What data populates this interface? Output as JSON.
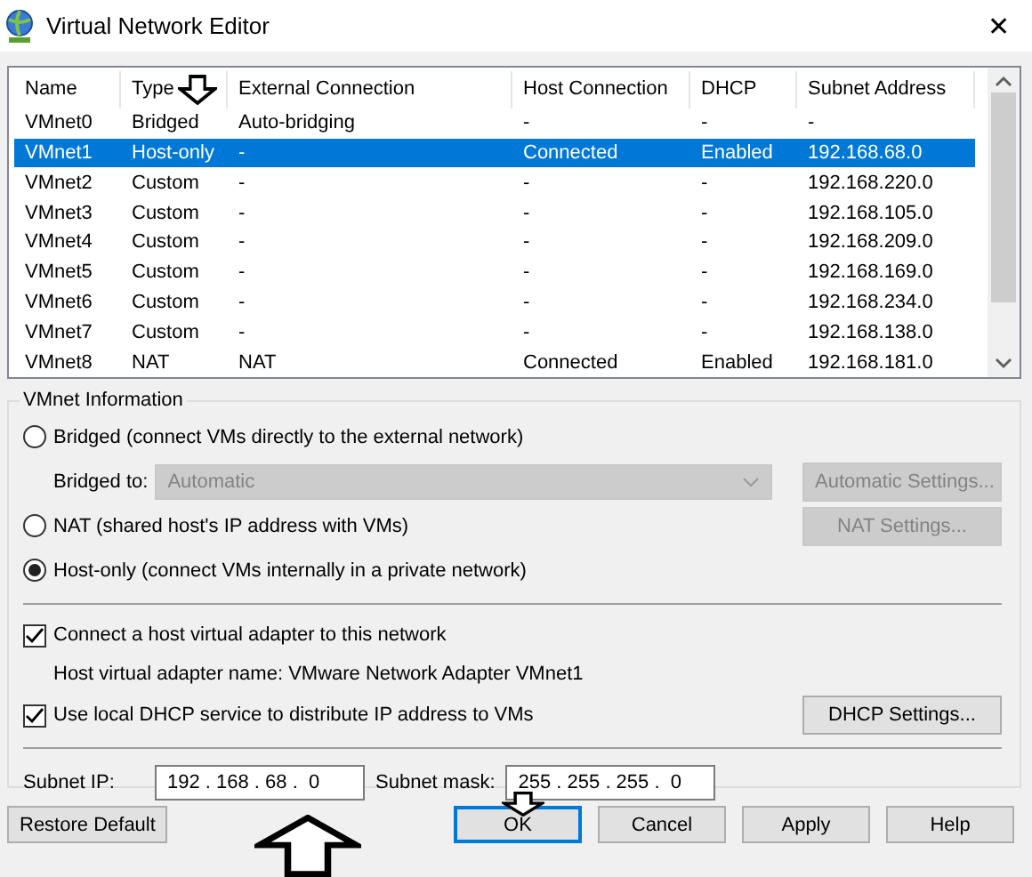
{
  "window": {
    "title": "Virtual Network Editor",
    "close": "✕"
  },
  "network_table": {
    "columns": [
      "Name",
      "Type",
      "External Connection",
      "Host Connection",
      "DHCP",
      "Subnet Address"
    ],
    "rows": [
      {
        "cells": [
          "VMnet0",
          "Bridged",
          "Auto-bridging",
          "-",
          "-",
          "-"
        ],
        "selected": false
      },
      {
        "cells": [
          "VMnet1",
          "Host-only",
          "-",
          "Connected",
          "Enabled",
          "192.168.68.0"
        ],
        "selected": true
      },
      {
        "cells": [
          "VMnet2",
          "Custom",
          "-",
          "-",
          "-",
          "192.168.220.0"
        ],
        "selected": false
      },
      {
        "cells": [
          "VMnet3",
          "Custom",
          "-",
          "-",
          "-",
          "192.168.105.0"
        ],
        "selected": false
      },
      {
        "cells": [
          "VMnet4",
          "Custom",
          "-",
          "-",
          "-",
          "192.168.209.0"
        ],
        "selected": false
      },
      {
        "cells": [
          "VMnet5",
          "Custom",
          "-",
          "-",
          "-",
          "192.168.169.0"
        ],
        "selected": false
      },
      {
        "cells": [
          "VMnet6",
          "Custom",
          "-",
          "-",
          "-",
          "192.168.234.0"
        ],
        "selected": false
      },
      {
        "cells": [
          "VMnet7",
          "Custom",
          "-",
          "-",
          "-",
          "192.168.138.0"
        ],
        "selected": false
      },
      {
        "cells": [
          "VMnet8",
          "NAT",
          "NAT",
          "Connected",
          "Enabled",
          "192.168.181.0"
        ],
        "selected": false
      }
    ]
  },
  "vmnet_info": {
    "title": "VMnet Information",
    "options": [
      {
        "label": "Bridged (connect VMs directly to the external network)",
        "selected": false
      },
      {
        "label": "NAT (shared host's IP address with VMs)",
        "selected": false
      },
      {
        "label": "Host-only (connect VMs internally in a private network)",
        "selected": true
      }
    ],
    "bridged_to": {
      "label": "Bridged to:",
      "value": "Automatic",
      "disabled": true
    },
    "automatic_settings": {
      "label": "Automatic Settings...",
      "disabled": true
    },
    "nat_settings": {
      "label": "NAT Settings...",
      "disabled": true
    },
    "checkboxes": [
      {
        "label": "Connect a host virtual adapter to this network",
        "checked": true
      },
      {
        "label": "Use local DHCP service to distribute IP address to VMs",
        "checked": true
      }
    ],
    "adapter_name": "Host virtual adapter name: VMware Network Adapter VMnet1",
    "dhcp_settings": {
      "label": "DHCP Settings...",
      "disabled": false
    },
    "subnet_ip": {
      "label": "Subnet IP:",
      "value": "192 . 168 . 68 .  0"
    },
    "subnet_mask": {
      "label": "Subnet mask:",
      "value": "255 . 255 . 255 .  0"
    }
  },
  "buttons": [
    {
      "label": "Restore Default",
      "default": false
    },
    {
      "label": "OK",
      "default": true
    },
    {
      "label": "Cancel",
      "default": false
    },
    {
      "label": "Apply",
      "default": false
    },
    {
      "label": "Help",
      "default": false
    }
  ]
}
